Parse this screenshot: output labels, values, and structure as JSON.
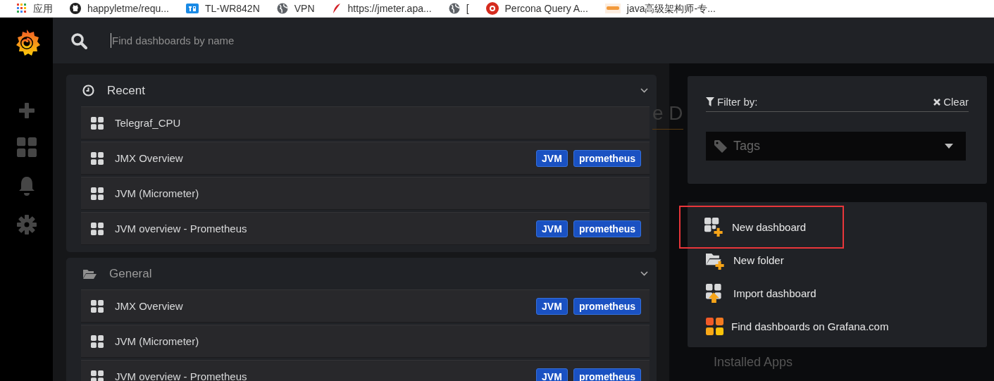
{
  "bookmarks": [
    {
      "label": "应用",
      "kind": "apps"
    },
    {
      "label": "happyletme/requ...",
      "kind": "github"
    },
    {
      "label": "TL-WR842N",
      "kind": "tp"
    },
    {
      "label": "VPN",
      "kind": "globe"
    },
    {
      "label": "https://jmeter.apa...",
      "kind": "feather"
    },
    {
      "label": "[",
      "kind": "globe"
    },
    {
      "label": "Percona Query A...",
      "kind": "percona"
    },
    {
      "label": "java高级架构师-专...",
      "kind": "thumb"
    }
  ],
  "search": {
    "placeholder": "Find dashboards by name"
  },
  "sections": [
    {
      "title": "Recent",
      "kind": "recent",
      "rows": [
        {
          "title": "Telegraf_CPU"
        },
        {
          "title": "JMX Overview",
          "tags": [
            "JVM",
            "prometheus"
          ]
        },
        {
          "title": "JVM (Micrometer)"
        },
        {
          "title": "JVM overview - Prometheus",
          "tags": [
            "JVM",
            "prometheus"
          ]
        }
      ]
    },
    {
      "title": "General",
      "kind": "folder",
      "rows": [
        {
          "title": "JMX Overview",
          "tags": [
            "JVM",
            "prometheus"
          ]
        },
        {
          "title": "JVM (Micrometer)"
        },
        {
          "title": "JVM overview - Prometheus",
          "tags": [
            "JVM",
            "prometheus"
          ]
        }
      ]
    }
  ],
  "background": {
    "heading_fragment": "e D",
    "link": "Installed Apps"
  },
  "filter": {
    "label": "Filter by:",
    "clear": "Clear",
    "tags_placeholder": "Tags"
  },
  "actions": [
    {
      "label": "New dashboard",
      "kind": "new-dashboard",
      "highlighted": true
    },
    {
      "label": "New folder",
      "kind": "new-folder",
      "highlighted": false
    },
    {
      "label": "Import dashboard",
      "kind": "import",
      "highlighted": false
    },
    {
      "label": "Find dashboards on Grafana.com",
      "kind": "grafana-com",
      "highlighted": false
    }
  ]
}
